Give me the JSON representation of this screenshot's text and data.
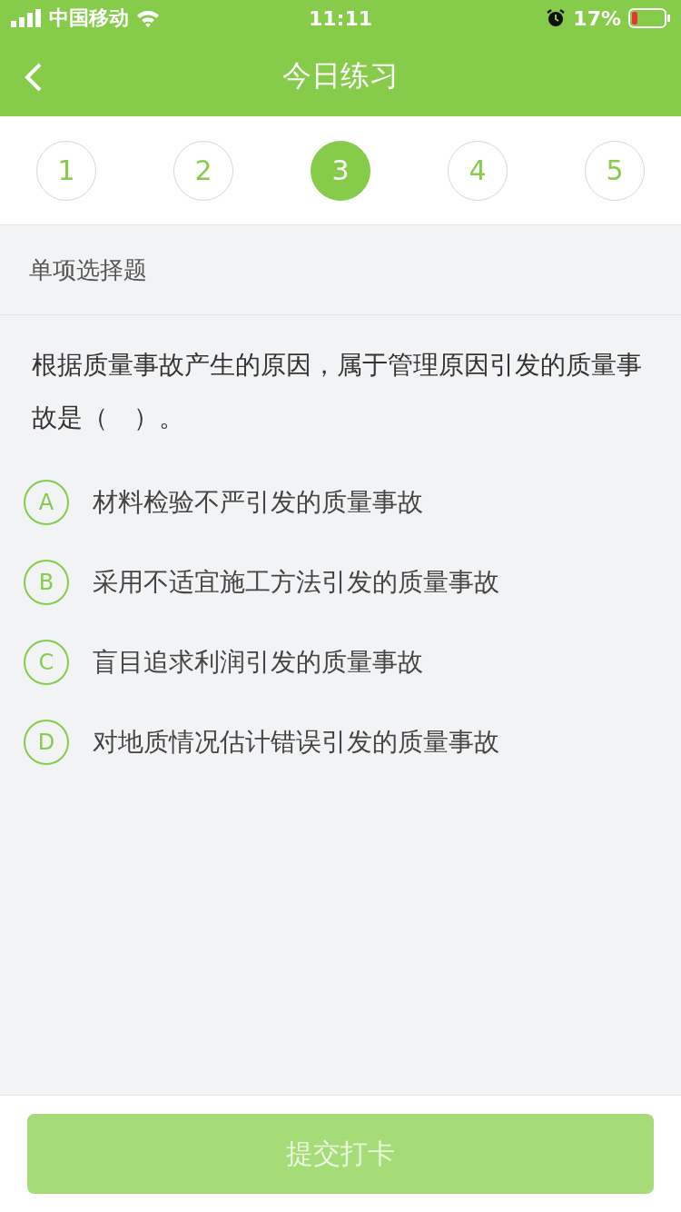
{
  "status_bar": {
    "carrier": "中国移动",
    "time": "11:11",
    "battery": "17%"
  },
  "nav": {
    "title": "今日练习"
  },
  "question_numbers": [
    {
      "label": "1",
      "selected": false
    },
    {
      "label": "2",
      "selected": false
    },
    {
      "label": "3",
      "selected": true
    },
    {
      "label": "4",
      "selected": false
    },
    {
      "label": "5",
      "selected": false
    }
  ],
  "question_type": "单项选择题",
  "question": "根据质量事故产生的原因，属于管理原因引发的质量事故是（　）。",
  "options": [
    {
      "letter": "A",
      "text": "材料检验不严引发的质量事故",
      "selected": false
    },
    {
      "letter": "B",
      "text": "采用不适宜施工方法引发的质量事故",
      "selected": false
    },
    {
      "letter": "C",
      "text": "盲目追求利润引发的质量事故",
      "selected": false
    },
    {
      "letter": "D",
      "text": "对地质情况估计错误引发的质量事故",
      "selected": false
    }
  ],
  "submit": {
    "label": "提交打卡",
    "disabled": true
  }
}
